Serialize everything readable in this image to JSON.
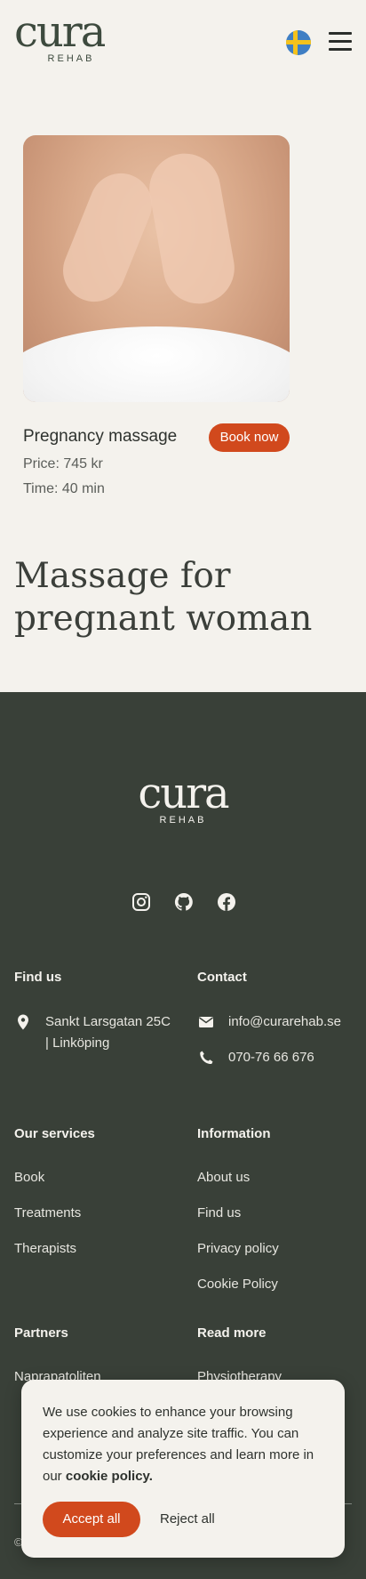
{
  "header": {
    "logo_word": "cura",
    "logo_sub": "REHAB",
    "language_icon": "sweden-flag-icon",
    "menu_icon": "hamburger-menu-icon"
  },
  "service": {
    "title": "Pregnancy massage",
    "book_label": "Book now",
    "price": "Price: 745 kr",
    "time": "Time: 40 min"
  },
  "main": {
    "headline": "Massage for pregnant woman"
  },
  "footer": {
    "logo_word": "cura",
    "logo_sub": "REHAB",
    "socials": [
      "instagram-icon",
      "github-icon",
      "facebook-icon"
    ],
    "find_us": {
      "heading": "Find us",
      "address_line1": "Sankt Larsgatan 25C",
      "address_line2": "| Linköping"
    },
    "contact": {
      "heading": "Contact",
      "email": "info@curarehab.se",
      "phone": "070-76 66 676"
    },
    "our_services": {
      "heading": "Our services",
      "items": [
        "Book",
        "Treatments",
        "Therapists"
      ]
    },
    "information": {
      "heading": "Information",
      "items": [
        "About us",
        "Find us",
        "Privacy policy",
        "Cookie Policy"
      ]
    },
    "partners": {
      "heading": "Partners",
      "items": [
        "Naprapatoliten"
      ]
    },
    "read_more": {
      "heading": "Read more",
      "items": [
        "Physiotherapy"
      ]
    },
    "copyright": "©"
  },
  "cookie_banner": {
    "message": "We use cookies to enhance your browsing experience and analyze site traffic. You can customize your preferences and learn more in our ",
    "link": "cookie policy.",
    "accept_label": "Accept all",
    "reject_label": "Reject all"
  },
  "colors": {
    "accent": "#d1491d",
    "footer_bg": "#394038",
    "page_bg": "#f4f2ed"
  }
}
